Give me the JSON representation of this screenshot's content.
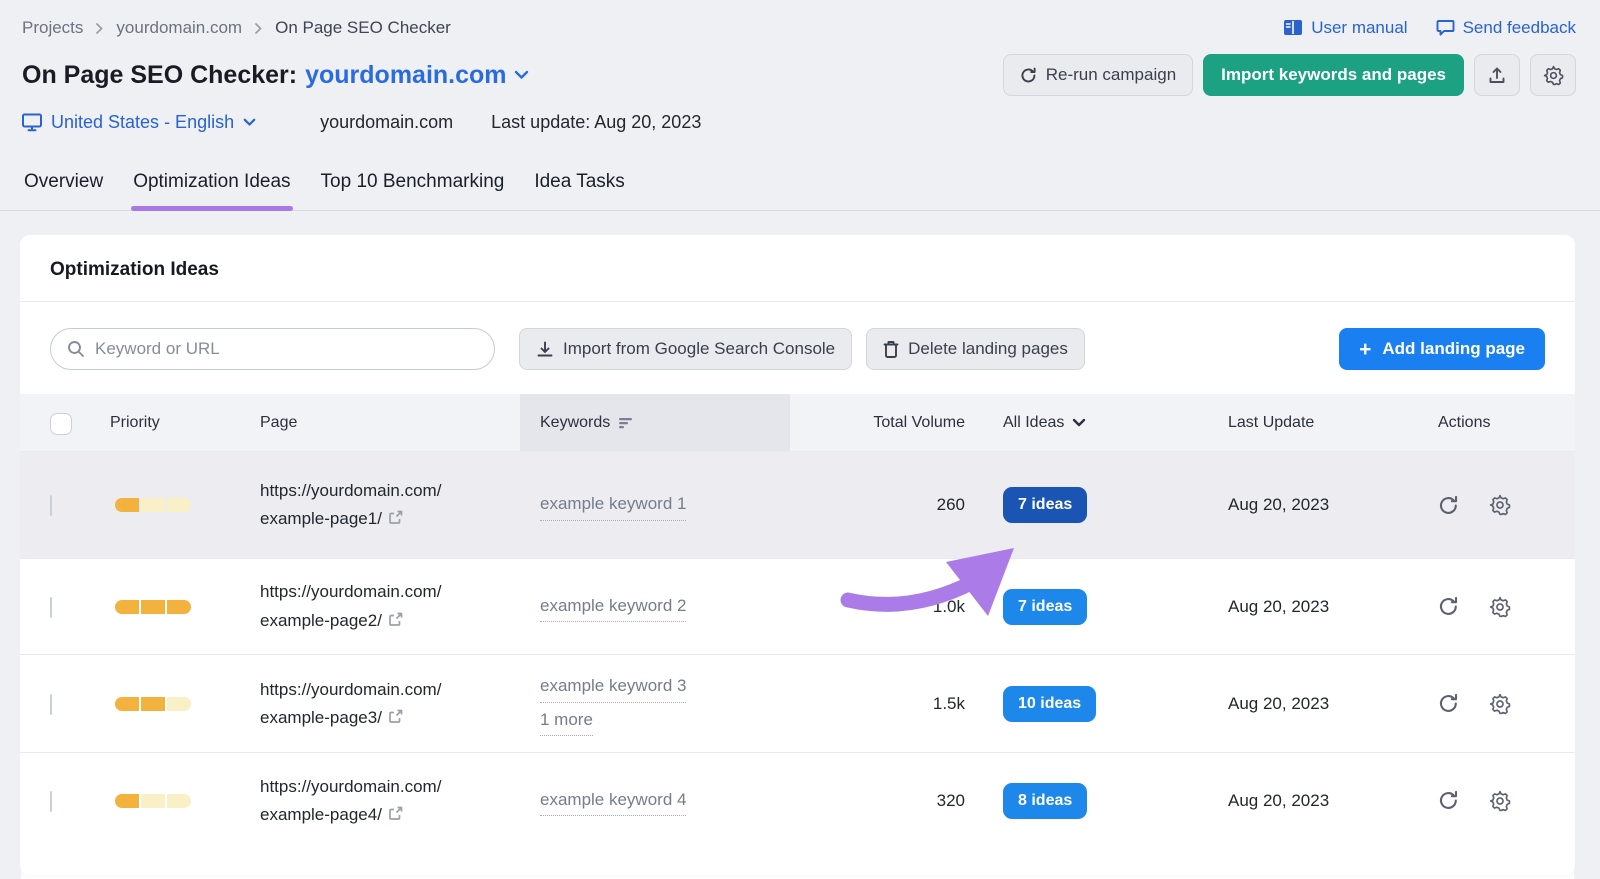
{
  "breadcrumb": {
    "items": [
      "Projects",
      "yourdomain.com",
      "On Page SEO Checker"
    ]
  },
  "top_links": {
    "user_manual": "User manual",
    "send_feedback": "Send feedback"
  },
  "title": {
    "prefix": "On Page SEO Checker:",
    "domain": "yourdomain.com"
  },
  "header_actions": {
    "rerun": "Re-run campaign",
    "import_keywords": "Import keywords and pages"
  },
  "meta": {
    "locale": "United States - English",
    "domain": "yourdomain.com",
    "last_update": "Last update: Aug 20, 2023"
  },
  "tabs": [
    {
      "label": "Overview",
      "active": false
    },
    {
      "label": "Optimization Ideas",
      "active": true
    },
    {
      "label": "Top 10 Benchmarking",
      "active": false
    },
    {
      "label": "Idea Tasks",
      "active": false
    }
  ],
  "card": {
    "title": "Optimization Ideas"
  },
  "toolbar": {
    "search_placeholder": "Keyword or URL",
    "import_gsc": "Import from Google Search Console",
    "delete_pages": "Delete landing pages",
    "add_page": "Add landing page"
  },
  "table": {
    "columns": {
      "priority": "Priority",
      "page": "Page",
      "keywords": "Keywords",
      "total_volume": "Total Volume",
      "all_ideas": "All Ideas",
      "last_update": "Last Update",
      "actions": "Actions"
    },
    "rows": [
      {
        "priority": 1,
        "url_line1": "https://yourdomain.com/",
        "url_line2": "example-page1/",
        "keyword": "example keyword 1",
        "volume": "260",
        "ideas": "7 ideas",
        "date": "Aug 20, 2023"
      },
      {
        "priority": 3,
        "url_line1": "https://yourdomain.com/",
        "url_line2": "example-page2/",
        "keyword": "example keyword 2",
        "volume": "1.0k",
        "ideas": "7 ideas",
        "date": "Aug 20, 2023"
      },
      {
        "priority": 2,
        "url_line1": "https://yourdomain.com/",
        "url_line2": "example-page3/",
        "keyword": "example keyword 3",
        "keyword_more": "1 more",
        "volume": "1.5k",
        "ideas": "10 ideas",
        "date": "Aug 20, 2023"
      },
      {
        "priority": 1,
        "url_line1": "https://yourdomain.com/",
        "url_line2": "example-page4/",
        "keyword": "example keyword 4",
        "volume": "320",
        "ideas": "8 ideas",
        "date": "Aug 20, 2023"
      }
    ]
  },
  "colors": {
    "accent_purple_underline": "#a678e8",
    "annotation_arrow_purple": "#ab7ce8",
    "green_button": "#1ca182",
    "blue_button": "#1a7ff0",
    "ideas_button_blue": "#1e88ea",
    "ideas_button_dark_blue": "#1b55b4",
    "priority_filled": "#f3b13e",
    "priority_empty": "#faf0c8",
    "link_blue": "#2a62cf"
  }
}
